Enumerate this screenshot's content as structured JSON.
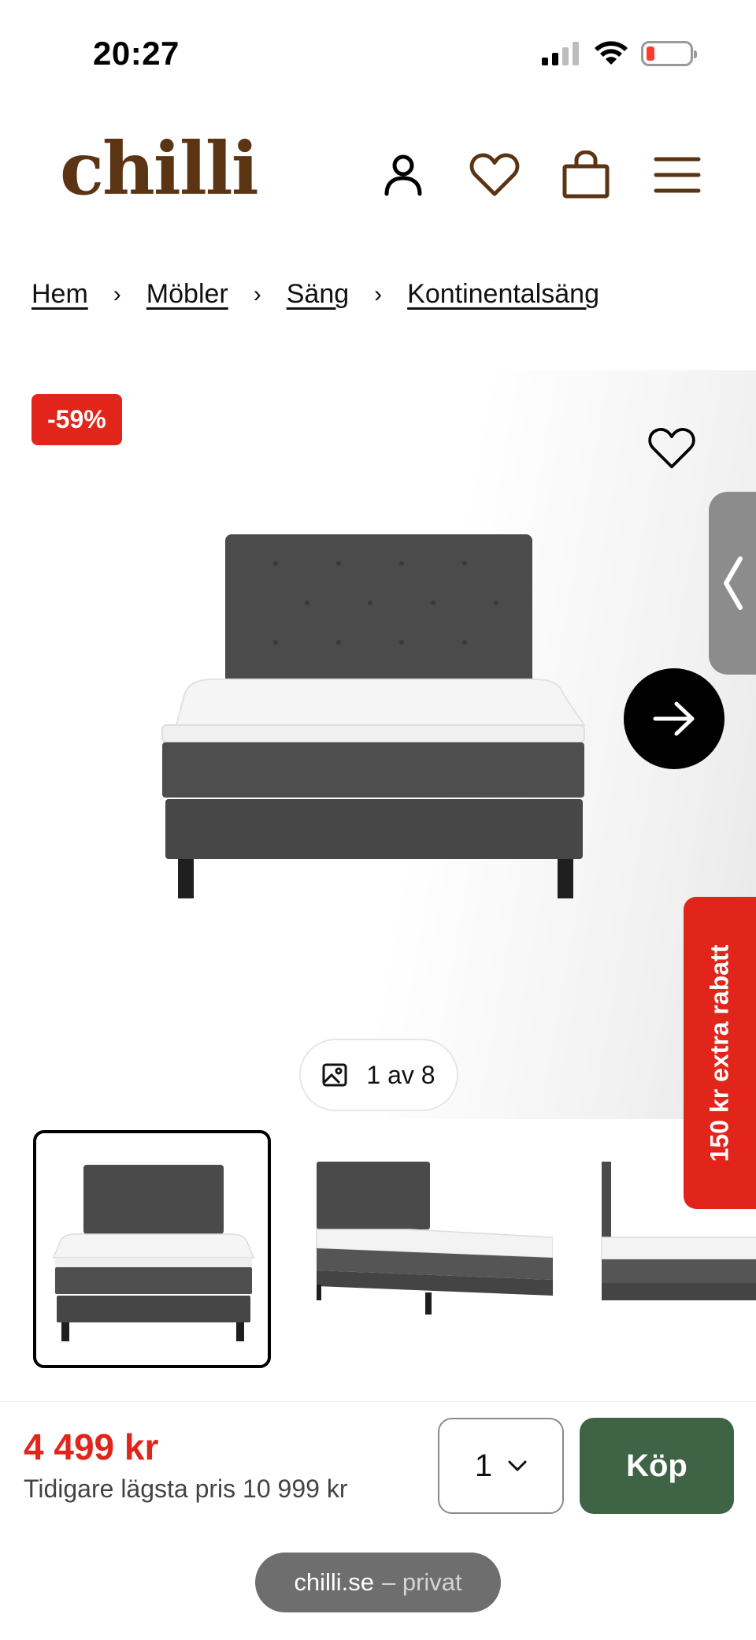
{
  "status_bar": {
    "time": "20:27"
  },
  "header": {
    "logo_text": "chilli",
    "brand_color": "#5b3414"
  },
  "breadcrumb": {
    "items": [
      "Hem",
      "Möbler",
      "Säng",
      "Kontinentalsäng"
    ],
    "separator": "›"
  },
  "product": {
    "discount_badge": "-59%",
    "image_counter": "1 av 8",
    "promo_tab": "150 kr extra rabatt",
    "price": "4 499 kr",
    "previous_lowest_price": "Tidigare lägsta pris 10 999 kr",
    "quantity": "1",
    "buy_label": "Köp",
    "accent_color": "#e2251b",
    "buy_color": "#3f6345"
  },
  "browser": {
    "domain": "chilli.se",
    "mode": "– privat"
  },
  "icons": [
    "account-icon",
    "heart-icon",
    "bag-icon",
    "menu-icon",
    "image-icon",
    "arrow-right-icon",
    "chevron-left-icon",
    "chevron-down-icon"
  ]
}
